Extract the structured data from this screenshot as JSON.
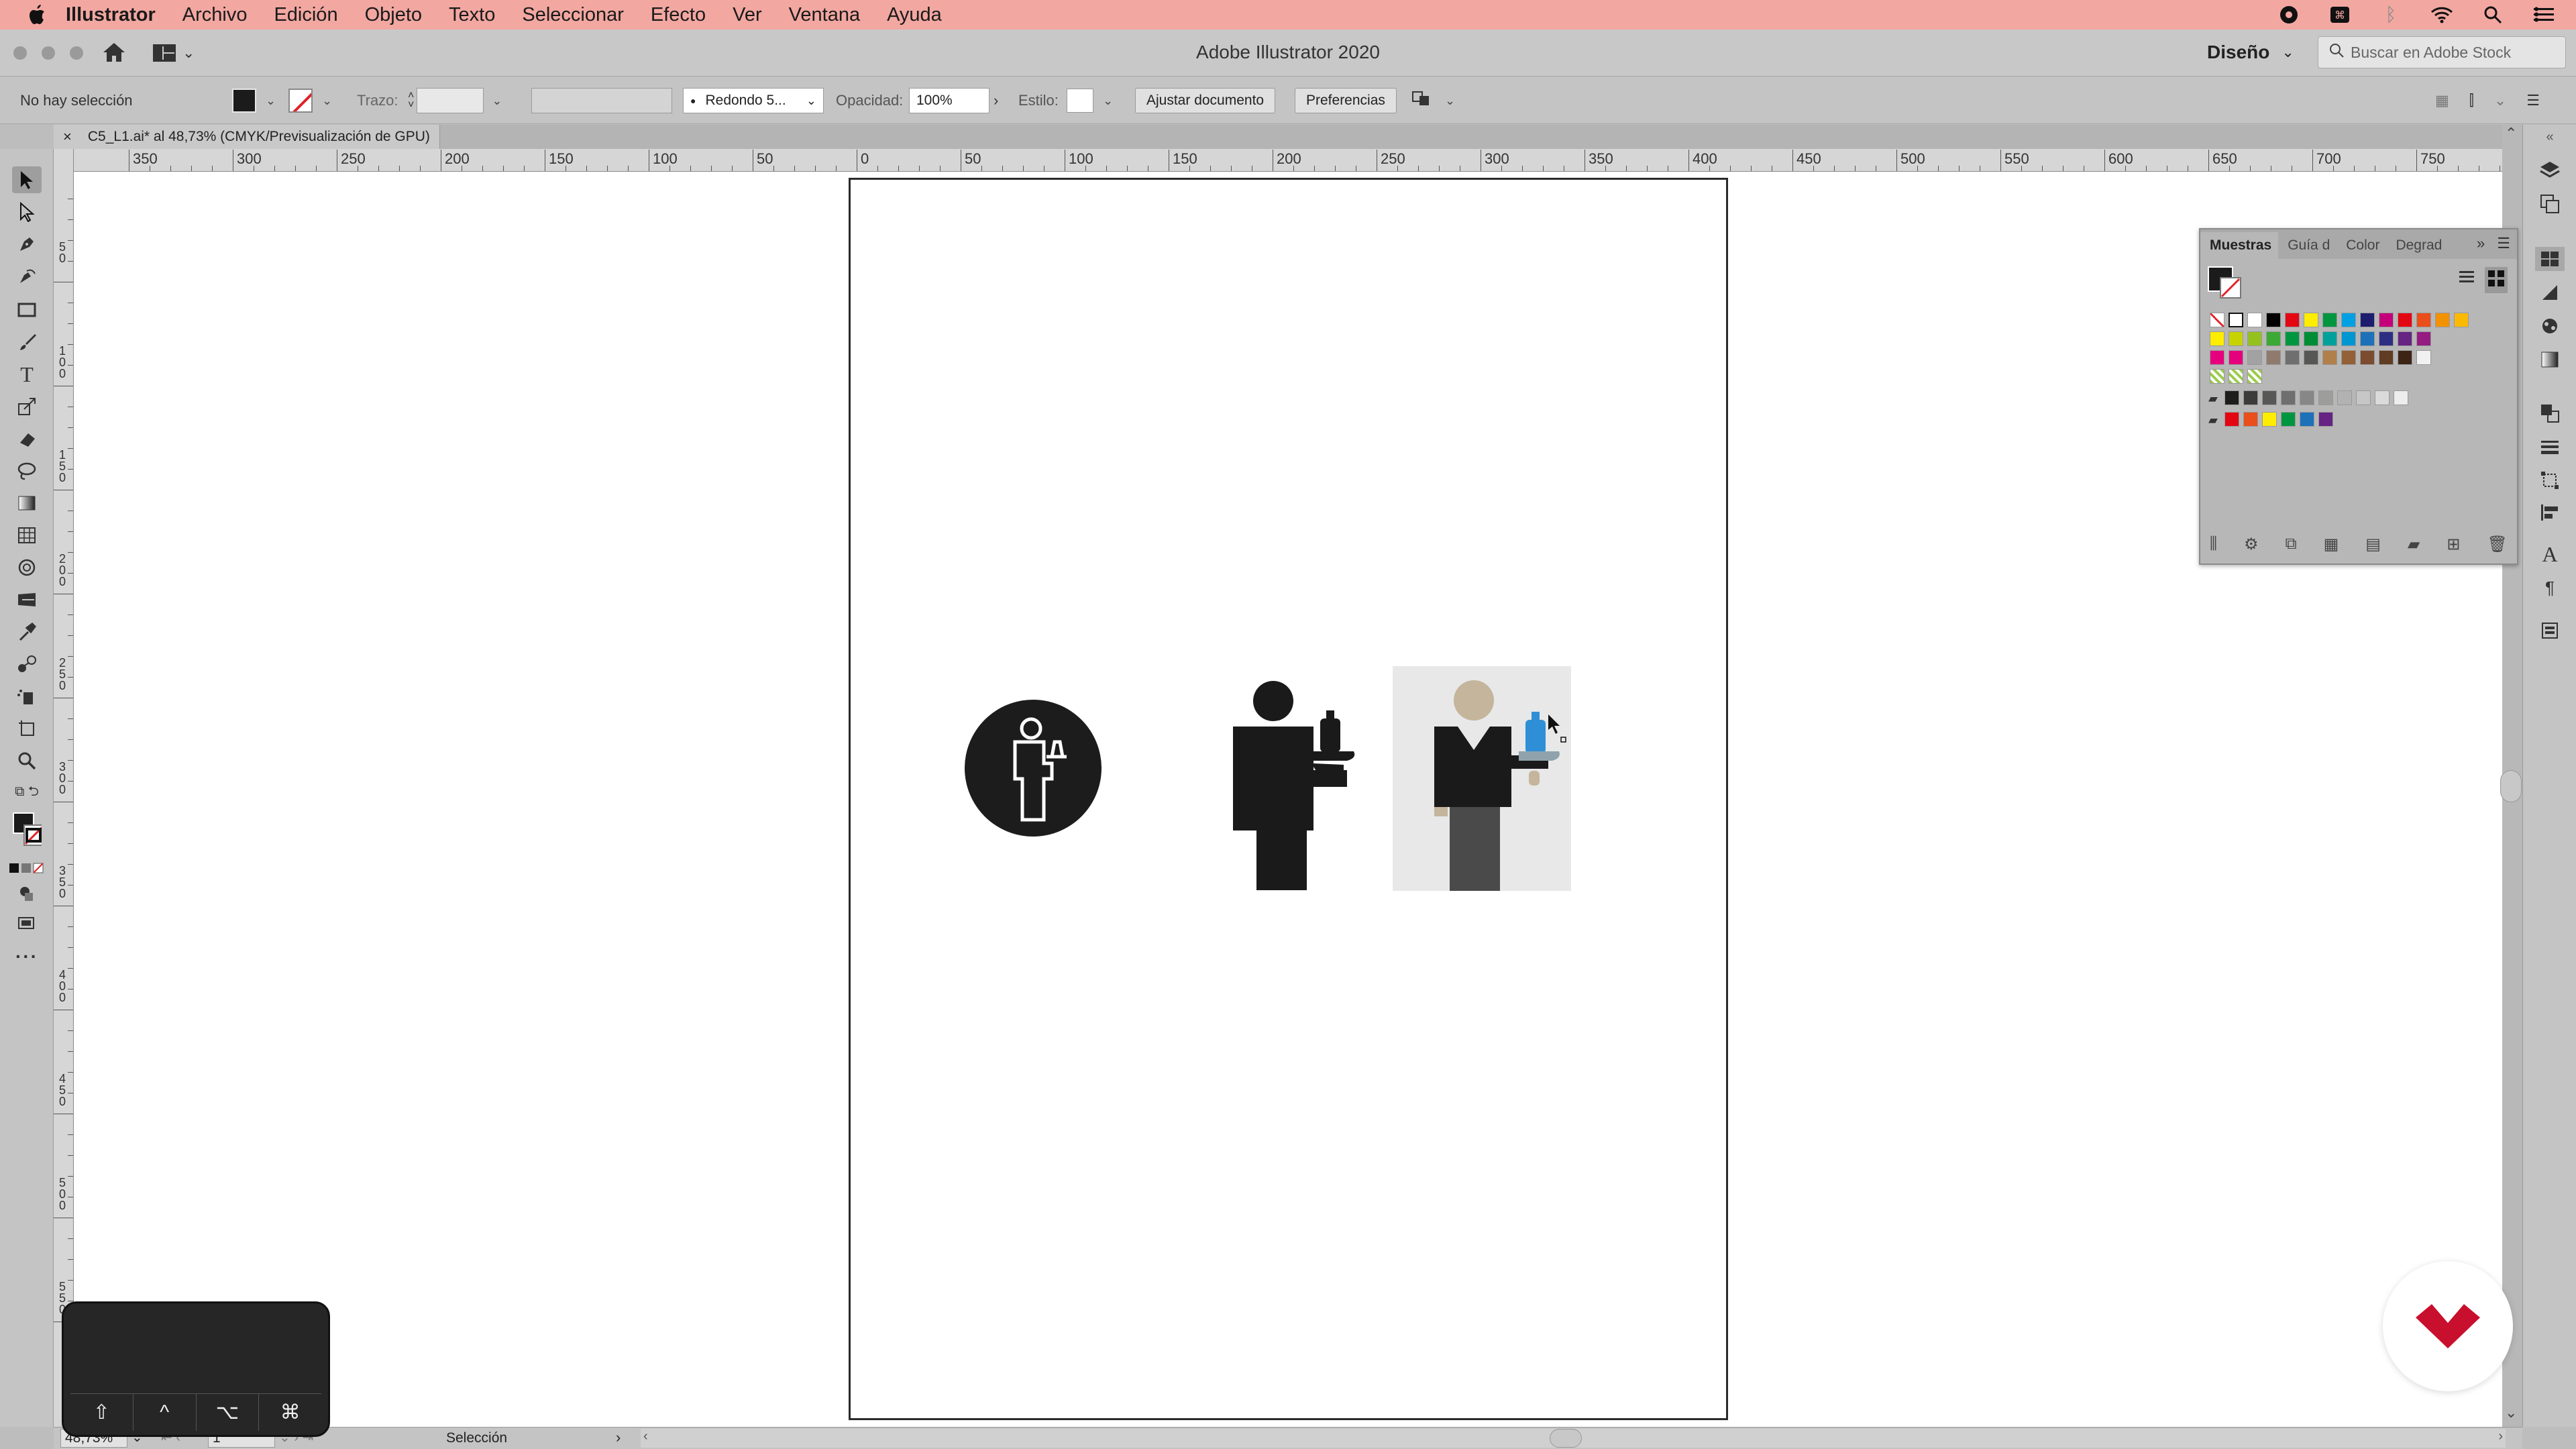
{
  "menubar": {
    "app": "Illustrator",
    "items": [
      "Archivo",
      "Edición",
      "Objeto",
      "Texto",
      "Seleccionar",
      "Efecto",
      "Ver",
      "Ventana",
      "Ayuda"
    ]
  },
  "titlebar": {
    "title": "Adobe Illustrator 2020",
    "workspace": "Diseño",
    "stock_placeholder": "Buscar en Adobe Stock"
  },
  "control": {
    "selection": "No hay selección",
    "stroke_label": "Trazo:",
    "brush": "Redondo 5...",
    "opacity_label": "Opacidad:",
    "opacity_value": "100%",
    "style_label": "Estilo:",
    "doc_button": "Ajustar documento",
    "prefs_button": "Preferencias"
  },
  "tab": {
    "name": "C5_L1.ai* al 48,73% (CMYK/Previsualización de GPU)"
  },
  "ruler": {
    "h_labels": [
      "350",
      "300",
      "250",
      "200",
      "150",
      "100",
      "50",
      "0",
      "50",
      "100",
      "150",
      "200",
      "250",
      "300",
      "350",
      "400",
      "450",
      "500",
      "550",
      "600",
      "650",
      "700",
      "750"
    ],
    "v_labels": [
      "50",
      "100",
      "150",
      "200",
      "250",
      "300",
      "350",
      "400",
      "450",
      "500",
      "550"
    ]
  },
  "swatches": {
    "tabs": [
      "Muestras",
      "Guía d",
      "Color",
      "Degrad"
    ],
    "row1": [
      "#ffffff",
      "#000000",
      "#e30613",
      "#ffed00",
      "#009640",
      "#00a0e3",
      "#1d1d70",
      "#c4007a",
      "#e30613",
      "#e94e1b",
      "#f39200",
      "#fbba00"
    ],
    "row2": [
      "#ffed00",
      "#c7d300",
      "#95c11f",
      "#3aaa35",
      "#009640",
      "#008d36",
      "#00a19a",
      "#0096d2",
      "#1d71b8",
      "#2d2e83",
      "#662483",
      "#951b81"
    ],
    "row3": [
      "#e6007e",
      "#e5007d",
      "#a2a2a2",
      "#8f7b6e",
      "#706f6f",
      "#575756",
      "#b17f4a",
      "#936037",
      "#7b4c2f",
      "#5f3c22",
      "#3c2515",
      "#f1f1f1"
    ],
    "grays": [
      "#1d1d1b",
      "#3c3c3b",
      "#575756",
      "#706f6f",
      "#878787",
      "#9d9d9c",
      "#b2b2b2",
      "#c6c6c6",
      "#dadada",
      "#ededed"
    ],
    "brights": [
      "#e30613",
      "#e94e1b",
      "#ffed00",
      "#009640",
      "#1d71b8",
      "#662483"
    ]
  },
  "status": {
    "zoom": "48,73%",
    "page": "1",
    "tool": "Selección"
  },
  "keys": [
    "⇧",
    "^",
    "⌥",
    "⌘"
  ],
  "colors": {
    "menubar": "#f2a7a1",
    "accent_blue": "#2f8fd6",
    "skin": "#c4b59c",
    "trouser": "#4a4a4a",
    "brand_red": "#c8102e"
  }
}
